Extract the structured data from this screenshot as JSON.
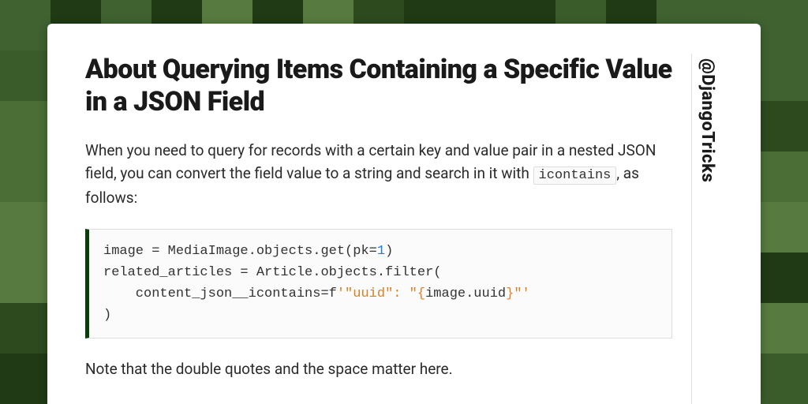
{
  "bg": {
    "palette": [
      "#2d4a1f",
      "#3a5c2a",
      "#4a6e35",
      "#567a3f",
      "#1f3a14",
      "#3f6230"
    ],
    "cols": 16,
    "rows": 8
  },
  "card": {
    "title": "About Querying Items Containing a Specific Value in a JSON Field",
    "handle": "@DjangoTricks",
    "intro": {
      "pre": "When you need to query for records with a certain key and value pair in a nested JSON field, you can convert the field value to a string and search in it with ",
      "code": "icontains",
      "post": ", as follows:"
    },
    "code": {
      "l1a": "image = MediaImage.objects.get(pk=",
      "l1num": "1",
      "l1b": ")",
      "l2": "related_articles = Article.objects.filter(",
      "l3a": "    content_json__icontains=f",
      "l3s1": "'\"uuid\": \"",
      "l3i_open": "{",
      "l3i_body": "image.uuid",
      "l3i_close": "}",
      "l3s2": "\"'",
      "l4": ")"
    },
    "note": "Note that the double quotes and the space matter here."
  }
}
